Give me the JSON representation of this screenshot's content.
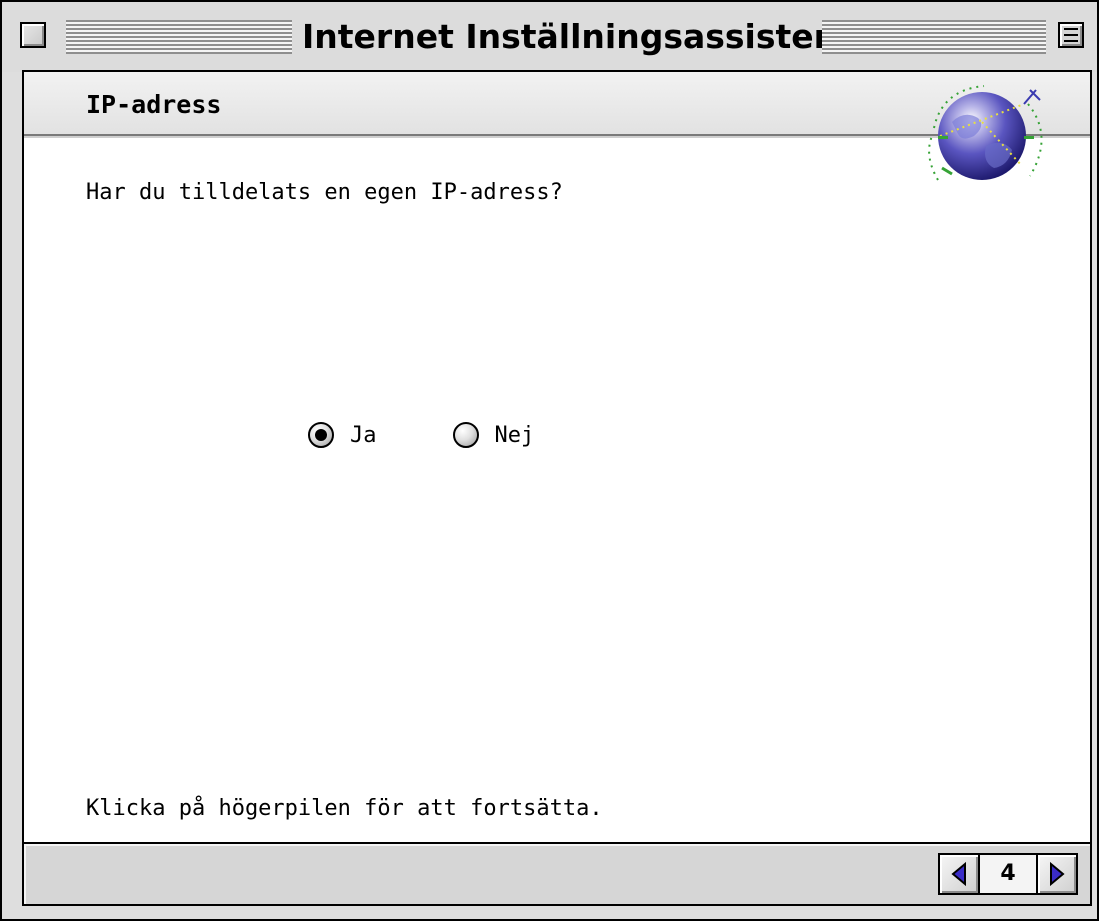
{
  "window": {
    "title": "Internet Inställningsassistent"
  },
  "page": {
    "title": "IP-adress",
    "question": "Har du tilldelats en egen IP-adress?",
    "hint": "Klicka på högerpilen för att fortsätta."
  },
  "options": [
    {
      "label": "Ja",
      "selected": true
    },
    {
      "label": "Nej",
      "selected": false
    }
  ],
  "navigation": {
    "step": "4",
    "back_icon": "triangle-left-icon",
    "next_icon": "triangle-right-icon"
  },
  "icons": {
    "header_art": "globe-icon",
    "close": "close-box-icon",
    "collapse": "collapse-box-icon"
  },
  "colors": {
    "arrow_fill": "#3a2cc8",
    "globe_blue": "#3b3aa8",
    "window_gray": "#dedede"
  }
}
